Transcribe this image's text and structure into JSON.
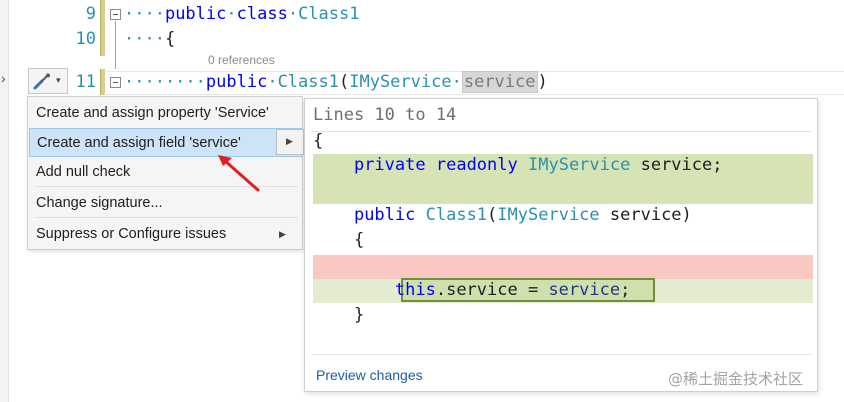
{
  "editor": {
    "lines": [
      {
        "number": "9",
        "dots": "····",
        "tokens": [
          {
            "text": "public",
            "kind": "kw"
          },
          {
            "text": "·",
            "kind": "dots"
          },
          {
            "text": "class",
            "kind": "kw"
          },
          {
            "text": "·",
            "kind": "dots"
          },
          {
            "text": "Class1",
            "kind": "type"
          }
        ]
      },
      {
        "number": "10",
        "dots": "····",
        "tokens": [
          {
            "text": "{",
            "kind": "plain"
          }
        ]
      },
      {
        "number": "11",
        "dots": "········",
        "tokens": [
          {
            "text": "public",
            "kind": "kw"
          },
          {
            "text": "·",
            "kind": "dots"
          },
          {
            "text": "Class1",
            "kind": "type"
          },
          {
            "text": "(",
            "kind": "plain"
          },
          {
            "text": "IMyService",
            "kind": "type"
          },
          {
            "text": "·",
            "kind": "dots"
          },
          {
            "text": "service",
            "kind": "hl"
          },
          {
            "text": ")",
            "kind": "plain"
          }
        ]
      }
    ],
    "codelens": "0 references"
  },
  "quick_actions": {
    "button_icon": "screwdriver-icon",
    "items": [
      {
        "label": "Create and assign property 'Service'",
        "submenu": false,
        "selected": false
      },
      {
        "label": "Create and assign field 'service'",
        "submenu": true,
        "selected": true
      },
      {
        "label": "Add null check",
        "submenu": false,
        "selected": false
      },
      {
        "label": "Change signature...",
        "submenu": false,
        "selected": false
      },
      {
        "label": "Suppress or Configure issues",
        "submenu": true,
        "selected": false
      }
    ]
  },
  "preview": {
    "title": "Lines 10 to 14",
    "lines": [
      {
        "indent": "",
        "tokens": [
          {
            "text": "{",
            "kind": "plain"
          }
        ]
      },
      {
        "indent": "    ",
        "tokens": [
          {
            "text": "private",
            "kind": "kw"
          },
          {
            "text": " ",
            "kind": "plain"
          },
          {
            "text": "readonly",
            "kind": "kw"
          },
          {
            "text": " ",
            "kind": "plain"
          },
          {
            "text": "IMyService",
            "kind": "type"
          },
          {
            "text": " service;",
            "kind": "plain"
          }
        ]
      },
      {
        "indent": "",
        "tokens": []
      },
      {
        "indent": "    ",
        "tokens": [
          {
            "text": "public",
            "kind": "kw"
          },
          {
            "text": " ",
            "kind": "plain"
          },
          {
            "text": "Class1",
            "kind": "type"
          },
          {
            "text": "(",
            "kind": "plain"
          },
          {
            "text": "IMyService",
            "kind": "type"
          },
          {
            "text": " service)",
            "kind": "plain"
          }
        ]
      },
      {
        "indent": "    ",
        "tokens": [
          {
            "text": "{",
            "kind": "plain"
          }
        ]
      },
      {
        "indent": "",
        "tokens": []
      },
      {
        "indent": "        ",
        "tokens": [
          {
            "text": "this",
            "kind": "kw"
          },
          {
            "text": ".service = ",
            "kind": "plain"
          },
          {
            "text": "service",
            "kind": "ident"
          },
          {
            "text": ";",
            "kind": "plain"
          }
        ]
      },
      {
        "indent": "    ",
        "tokens": [
          {
            "text": "}",
            "kind": "plain"
          }
        ]
      }
    ],
    "footer_link": "Preview changes"
  },
  "watermark": "@稀土掘金技术社区",
  "colors": {
    "keyword": "#0000ff",
    "type": "#2b91af",
    "added_line": "#d6e3b5",
    "removed_line": "#f9c8c3",
    "selection": "#cde3f7",
    "arrow": "#e02020"
  }
}
